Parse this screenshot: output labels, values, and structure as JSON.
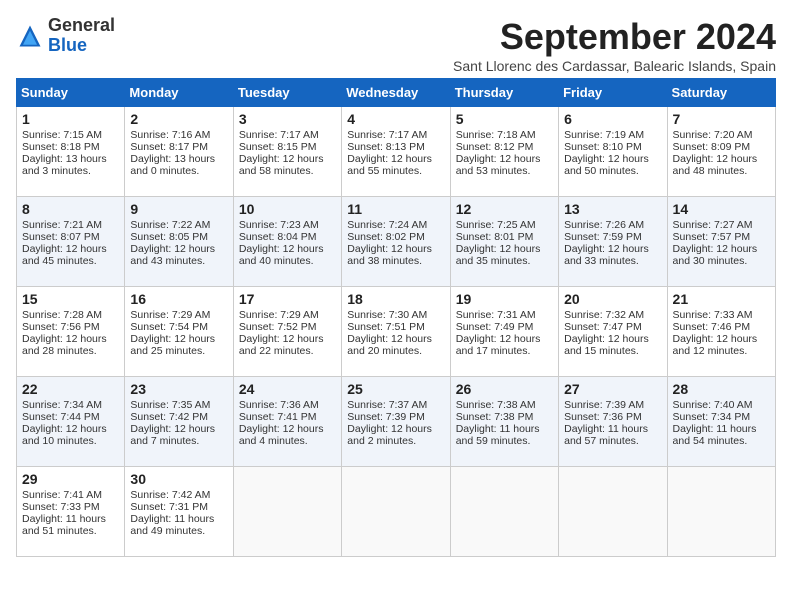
{
  "header": {
    "logo_general": "General",
    "logo_blue": "Blue",
    "title": "September 2024",
    "subtitle": "Sant Llorenc des Cardassar, Balearic Islands, Spain"
  },
  "columns": [
    "Sunday",
    "Monday",
    "Tuesday",
    "Wednesday",
    "Thursday",
    "Friday",
    "Saturday"
  ],
  "weeks": [
    [
      {
        "day": "1",
        "sunrise": "Sunrise: 7:15 AM",
        "sunset": "Sunset: 8:18 PM",
        "daylight": "Daylight: 13 hours and 3 minutes."
      },
      {
        "day": "2",
        "sunrise": "Sunrise: 7:16 AM",
        "sunset": "Sunset: 8:17 PM",
        "daylight": "Daylight: 13 hours and 0 minutes."
      },
      {
        "day": "3",
        "sunrise": "Sunrise: 7:17 AM",
        "sunset": "Sunset: 8:15 PM",
        "daylight": "Daylight: 12 hours and 58 minutes."
      },
      {
        "day": "4",
        "sunrise": "Sunrise: 7:17 AM",
        "sunset": "Sunset: 8:13 PM",
        "daylight": "Daylight: 12 hours and 55 minutes."
      },
      {
        "day": "5",
        "sunrise": "Sunrise: 7:18 AM",
        "sunset": "Sunset: 8:12 PM",
        "daylight": "Daylight: 12 hours and 53 minutes."
      },
      {
        "day": "6",
        "sunrise": "Sunrise: 7:19 AM",
        "sunset": "Sunset: 8:10 PM",
        "daylight": "Daylight: 12 hours and 50 minutes."
      },
      {
        "day": "7",
        "sunrise": "Sunrise: 7:20 AM",
        "sunset": "Sunset: 8:09 PM",
        "daylight": "Daylight: 12 hours and 48 minutes."
      }
    ],
    [
      {
        "day": "8",
        "sunrise": "Sunrise: 7:21 AM",
        "sunset": "Sunset: 8:07 PM",
        "daylight": "Daylight: 12 hours and 45 minutes."
      },
      {
        "day": "9",
        "sunrise": "Sunrise: 7:22 AM",
        "sunset": "Sunset: 8:05 PM",
        "daylight": "Daylight: 12 hours and 43 minutes."
      },
      {
        "day": "10",
        "sunrise": "Sunrise: 7:23 AM",
        "sunset": "Sunset: 8:04 PM",
        "daylight": "Daylight: 12 hours and 40 minutes."
      },
      {
        "day": "11",
        "sunrise": "Sunrise: 7:24 AM",
        "sunset": "Sunset: 8:02 PM",
        "daylight": "Daylight: 12 hours and 38 minutes."
      },
      {
        "day": "12",
        "sunrise": "Sunrise: 7:25 AM",
        "sunset": "Sunset: 8:01 PM",
        "daylight": "Daylight: 12 hours and 35 minutes."
      },
      {
        "day": "13",
        "sunrise": "Sunrise: 7:26 AM",
        "sunset": "Sunset: 7:59 PM",
        "daylight": "Daylight: 12 hours and 33 minutes."
      },
      {
        "day": "14",
        "sunrise": "Sunrise: 7:27 AM",
        "sunset": "Sunset: 7:57 PM",
        "daylight": "Daylight: 12 hours and 30 minutes."
      }
    ],
    [
      {
        "day": "15",
        "sunrise": "Sunrise: 7:28 AM",
        "sunset": "Sunset: 7:56 PM",
        "daylight": "Daylight: 12 hours and 28 minutes."
      },
      {
        "day": "16",
        "sunrise": "Sunrise: 7:29 AM",
        "sunset": "Sunset: 7:54 PM",
        "daylight": "Daylight: 12 hours and 25 minutes."
      },
      {
        "day": "17",
        "sunrise": "Sunrise: 7:29 AM",
        "sunset": "Sunset: 7:52 PM",
        "daylight": "Daylight: 12 hours and 22 minutes."
      },
      {
        "day": "18",
        "sunrise": "Sunrise: 7:30 AM",
        "sunset": "Sunset: 7:51 PM",
        "daylight": "Daylight: 12 hours and 20 minutes."
      },
      {
        "day": "19",
        "sunrise": "Sunrise: 7:31 AM",
        "sunset": "Sunset: 7:49 PM",
        "daylight": "Daylight: 12 hours and 17 minutes."
      },
      {
        "day": "20",
        "sunrise": "Sunrise: 7:32 AM",
        "sunset": "Sunset: 7:47 PM",
        "daylight": "Daylight: 12 hours and 15 minutes."
      },
      {
        "day": "21",
        "sunrise": "Sunrise: 7:33 AM",
        "sunset": "Sunset: 7:46 PM",
        "daylight": "Daylight: 12 hours and 12 minutes."
      }
    ],
    [
      {
        "day": "22",
        "sunrise": "Sunrise: 7:34 AM",
        "sunset": "Sunset: 7:44 PM",
        "daylight": "Daylight: 12 hours and 10 minutes."
      },
      {
        "day": "23",
        "sunrise": "Sunrise: 7:35 AM",
        "sunset": "Sunset: 7:42 PM",
        "daylight": "Daylight: 12 hours and 7 minutes."
      },
      {
        "day": "24",
        "sunrise": "Sunrise: 7:36 AM",
        "sunset": "Sunset: 7:41 PM",
        "daylight": "Daylight: 12 hours and 4 minutes."
      },
      {
        "day": "25",
        "sunrise": "Sunrise: 7:37 AM",
        "sunset": "Sunset: 7:39 PM",
        "daylight": "Daylight: 12 hours and 2 minutes."
      },
      {
        "day": "26",
        "sunrise": "Sunrise: 7:38 AM",
        "sunset": "Sunset: 7:38 PM",
        "daylight": "Daylight: 11 hours and 59 minutes."
      },
      {
        "day": "27",
        "sunrise": "Sunrise: 7:39 AM",
        "sunset": "Sunset: 7:36 PM",
        "daylight": "Daylight: 11 hours and 57 minutes."
      },
      {
        "day": "28",
        "sunrise": "Sunrise: 7:40 AM",
        "sunset": "Sunset: 7:34 PM",
        "daylight": "Daylight: 11 hours and 54 minutes."
      }
    ],
    [
      {
        "day": "29",
        "sunrise": "Sunrise: 7:41 AM",
        "sunset": "Sunset: 7:33 PM",
        "daylight": "Daylight: 11 hours and 51 minutes."
      },
      {
        "day": "30",
        "sunrise": "Sunrise: 7:42 AM",
        "sunset": "Sunset: 7:31 PM",
        "daylight": "Daylight: 11 hours and 49 minutes."
      },
      null,
      null,
      null,
      null,
      null
    ]
  ]
}
